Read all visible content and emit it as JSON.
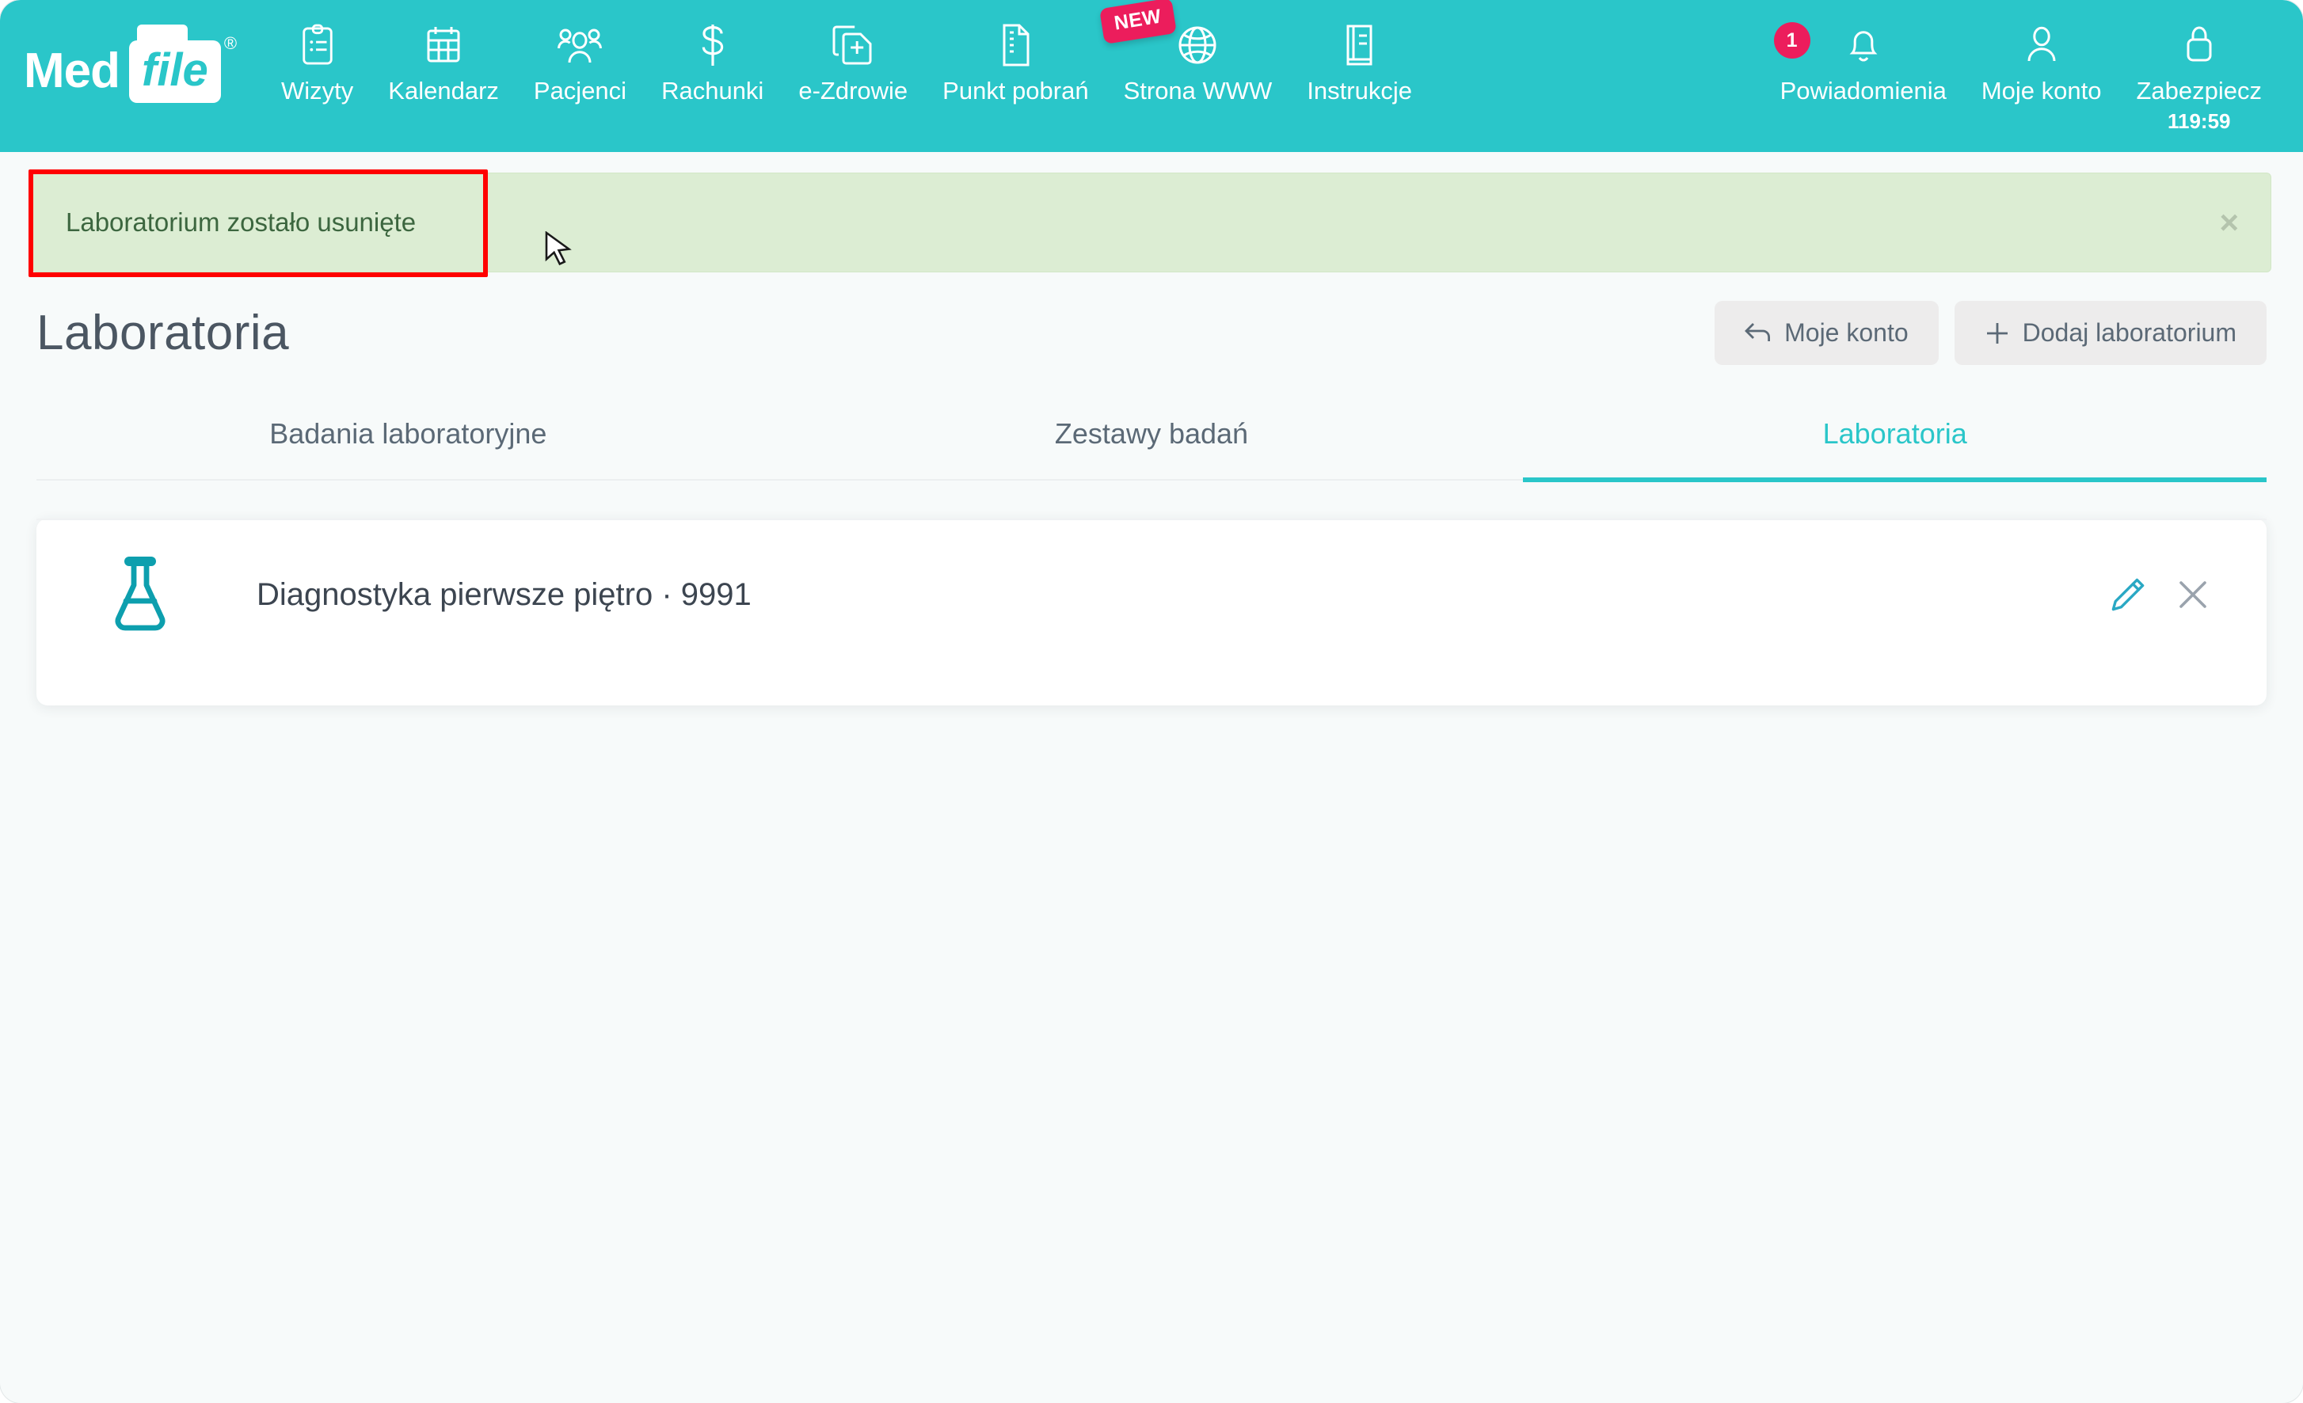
{
  "brand": {
    "med": "Med",
    "file": "file",
    "registered": "®"
  },
  "nav": {
    "items": [
      {
        "label": "Wizyty",
        "icon": "clipboard-icon"
      },
      {
        "label": "Kalendarz",
        "icon": "calendar-icon"
      },
      {
        "label": "Pacjenci",
        "icon": "users-icon"
      },
      {
        "label": "Rachunki",
        "icon": "dollar-icon"
      },
      {
        "label": "e-Zdrowie",
        "icon": "medical-files-icon"
      },
      {
        "label": "Punkt pobrań",
        "icon": "document-icon"
      },
      {
        "label": "Strona WWW",
        "icon": "globe-icon",
        "badge": "NEW"
      },
      {
        "label": "Instrukcje",
        "icon": "book-icon"
      }
    ],
    "right": [
      {
        "label": "Powiadomienia",
        "icon": "bell-icon",
        "count": "1"
      },
      {
        "label": "Moje konto",
        "icon": "user-icon"
      },
      {
        "label": "Zabezpiecz",
        "icon": "lock-icon",
        "sublabel": "119:59"
      }
    ]
  },
  "alert": {
    "message": "Laboratorium zostało usunięte",
    "close_label": "×"
  },
  "page": {
    "title": "Laboratoria"
  },
  "actions": {
    "back_label": "Moje konto",
    "add_label": "Dodaj laboratorium",
    "back_icon": "back-arrow-icon",
    "add_icon": "plus-icon"
  },
  "tabs": [
    {
      "label": "Badania laboratoryjne",
      "active": false
    },
    {
      "label": "Zestawy badań",
      "active": false
    },
    {
      "label": "Laboratoria",
      "active": true
    }
  ],
  "list": {
    "rows": [
      {
        "icon": "flask-icon",
        "label": "Diagnostyka pierwsze piętro · 9991",
        "edit_icon": "pencil-icon",
        "delete_icon": "close-icon"
      }
    ]
  },
  "colors": {
    "brand_teal": "#2ac6c9",
    "accent_pink": "#ec1d5c",
    "alert_bg": "#dcedd3",
    "alert_text": "#3c663f",
    "annotation_red": "#ff0000",
    "page_bg": "#f7fafa",
    "flask_teal": "#0d9fae"
  }
}
